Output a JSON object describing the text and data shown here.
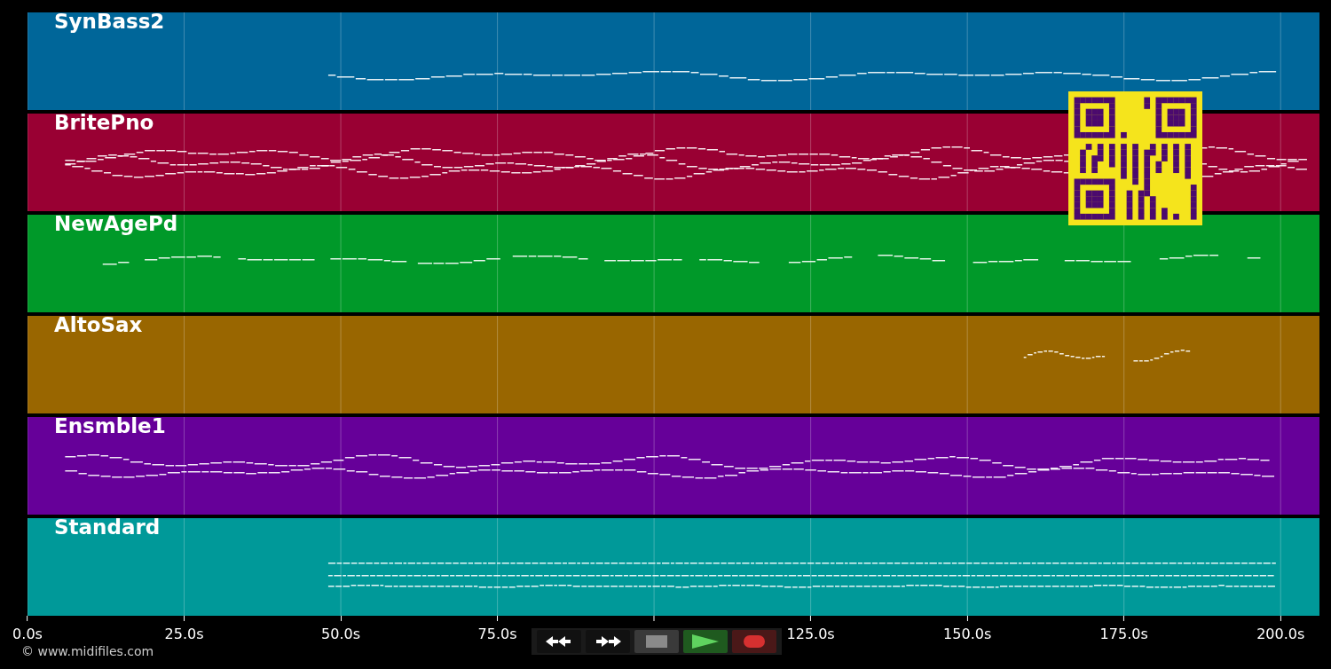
{
  "tracks": [
    {
      "name": "SynBass2",
      "color": "#006699"
    },
    {
      "name": "BritePno",
      "color": "#990033"
    },
    {
      "name": "NewAgePd",
      "color": "#009929"
    },
    {
      "name": "AltoSax",
      "color": "#996600"
    },
    {
      "name": "Ensmble1",
      "color": "#660099"
    },
    {
      "name": "Standard",
      "color": "#009999"
    }
  ],
  "axis_ticks": [
    {
      "label": "0.0s"
    },
    {
      "label": "25.0s"
    },
    {
      "label": "50.0s"
    },
    {
      "label": "75.0s"
    },
    {
      "covered": true
    },
    {
      "label": "125.0s"
    },
    {
      "label": "150.0s"
    },
    {
      "label": "175.0s"
    },
    {
      "label": "200.0s"
    }
  ],
  "copyright": "© www.midifiles.com",
  "controls": [
    {
      "kind": "rewind"
    },
    {
      "kind": "forward"
    },
    {
      "kind": "stop"
    },
    {
      "kind": "play"
    },
    {
      "kind": "record"
    }
  ]
}
